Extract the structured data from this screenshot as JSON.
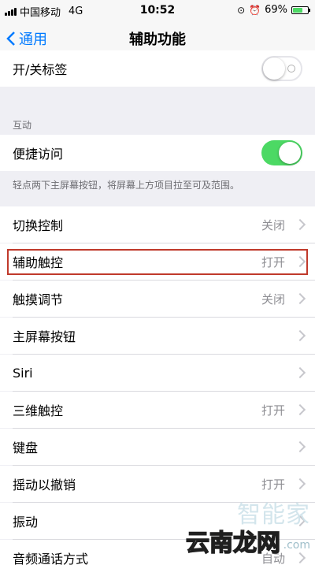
{
  "status_bar": {
    "carrier": "中国移动",
    "network": "4G",
    "time": "10:52",
    "battery": "69%",
    "battery_level": 0.69
  },
  "nav": {
    "back_label": "通用",
    "title": "辅助功能"
  },
  "rows": {
    "on_off_labels": {
      "label": "开/关标签",
      "state": "off"
    },
    "interaction_header": "互动",
    "reachability": {
      "label": "便捷访问",
      "state": "on"
    },
    "reachability_footer": "轻点两下主屏幕按钮，将屏幕上方项目拉至可及范围。",
    "switch_control": {
      "label": "切换控制",
      "value": "关闭"
    },
    "assistive_touch": {
      "label": "辅助触控",
      "value": "打开"
    },
    "touch_accommodations": {
      "label": "触摸调节",
      "value": "关闭"
    },
    "home_button": {
      "label": "主屏幕按钮"
    },
    "siri": {
      "label": "Siri"
    },
    "touch_3d": {
      "label": "三维触控",
      "value": "打开"
    },
    "keyboard": {
      "label": "键盘"
    },
    "shake_to_undo": {
      "label": "摇动以撤销",
      "value": "打开"
    },
    "vibration": {
      "label": "振动"
    },
    "call_audio_routing": {
      "label": "音频通话方式",
      "value": "自动"
    }
  },
  "watermark": {
    "top": "智能家",
    "main": "云南龙网",
    "sub": ".com"
  },
  "colors": {
    "accent": "#007aff",
    "toggle_on": "#4cd964",
    "highlight": "#c0392b"
  }
}
